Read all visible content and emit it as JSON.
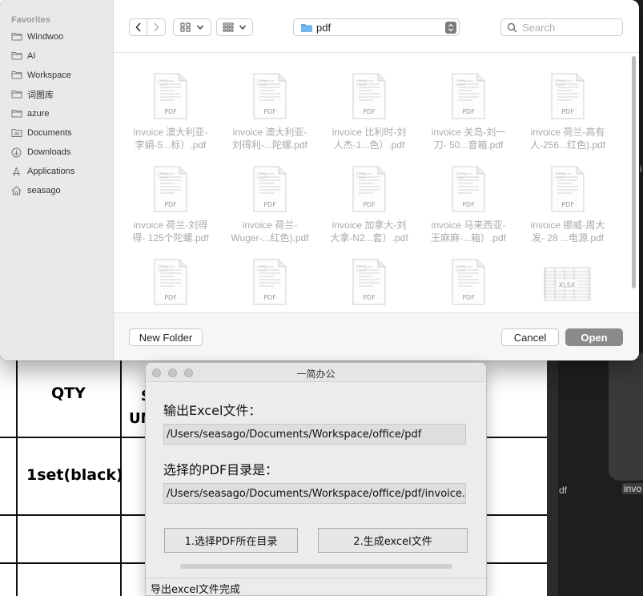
{
  "background_doc": {
    "qty_header": "QTY",
    "partial_header_1": "S",
    "partial_header_2": "UN",
    "qty_value": "1set(black)"
  },
  "right_area": {
    "label_left": "df",
    "label_tag": "invo",
    "label_mid": "i"
  },
  "file_dialog": {
    "sidebar": {
      "heading": "Favorites",
      "items": [
        {
          "label": "Windwoo",
          "icon": "folder-icon"
        },
        {
          "label": "AI",
          "icon": "folder-icon"
        },
        {
          "label": "Workspace",
          "icon": "folder-icon"
        },
        {
          "label": "词图库",
          "icon": "folder-icon"
        },
        {
          "label": "azure",
          "icon": "folder-icon"
        },
        {
          "label": "Documents",
          "icon": "document-icon"
        },
        {
          "label": "Downloads",
          "icon": "download-icon"
        },
        {
          "label": "Applications",
          "icon": "applications-icon"
        },
        {
          "label": "seasago",
          "icon": "home-icon"
        }
      ]
    },
    "toolbar": {
      "path_label": "pdf",
      "search_placeholder": "Search"
    },
    "files": [
      {
        "line1": "invoice 澳大利亚-",
        "line2": "李娟-5...标）.pdf",
        "type": "PDF"
      },
      {
        "line1": "invoice 澳大利亚-",
        "line2": "刘得利-...陀螺.pdf",
        "type": "PDF"
      },
      {
        "line1": "invoice 比利时-刘",
        "line2": "人杰-1...色）.pdf",
        "type": "PDF"
      },
      {
        "line1": "invoice 关岛-刘一",
        "line2": "刀- 50...音箱.pdf",
        "type": "PDF"
      },
      {
        "line1": "invoice 荷兰-高有",
        "line2": "人-256...红色).pdf",
        "type": "PDF"
      },
      {
        "line1": "invoice 荷兰-刘得",
        "line2": "得- 125个陀螺.pdf",
        "type": "PDF"
      },
      {
        "line1": "invoice 荷兰-",
        "line2": "Wuger-...红色).pdf",
        "type": "PDF"
      },
      {
        "line1": "invoice 加拿大-刘",
        "line2": "大拿-N2...套）.pdf",
        "type": "PDF"
      },
      {
        "line1": "invoice 马来西亚-",
        "line2": "王麻麻-...箱）.pdf",
        "type": "PDF"
      },
      {
        "line1": "invoice 挪威-周大",
        "line2": "发- 28 ...电源.pdf",
        "type": "PDF"
      },
      {
        "line1": "",
        "line2": "",
        "type": "PDF"
      },
      {
        "line1": "",
        "line2": "",
        "type": "PDF"
      },
      {
        "line1": "",
        "line2": "",
        "type": "PDF"
      },
      {
        "line1": "",
        "line2": "",
        "type": "PDF"
      },
      {
        "line1": "",
        "line2": "",
        "type": "XLSX"
      }
    ],
    "buttons": {
      "new_folder": "New Folder",
      "cancel": "Cancel",
      "open": "Open"
    }
  },
  "app_window": {
    "title": "一简办公",
    "excel_label": "输出Excel文件：",
    "excel_path": "/Users/seasago/Documents/Workspace/office/pdf",
    "pdf_label": "选择的PDF目录是：",
    "pdf_path": "/Users/seasago/Documents/Workspace/office/pdf/invoice.xlsx",
    "button_select": "1.选择PDF所在目录",
    "button_generate": "2.生成excel文件",
    "status": "导出excel文件完成"
  },
  "colors": {
    "open_button": "#8a8a8a",
    "sidebar_bg": "#e9e9e8",
    "path_folder": "#5aa9e6"
  }
}
